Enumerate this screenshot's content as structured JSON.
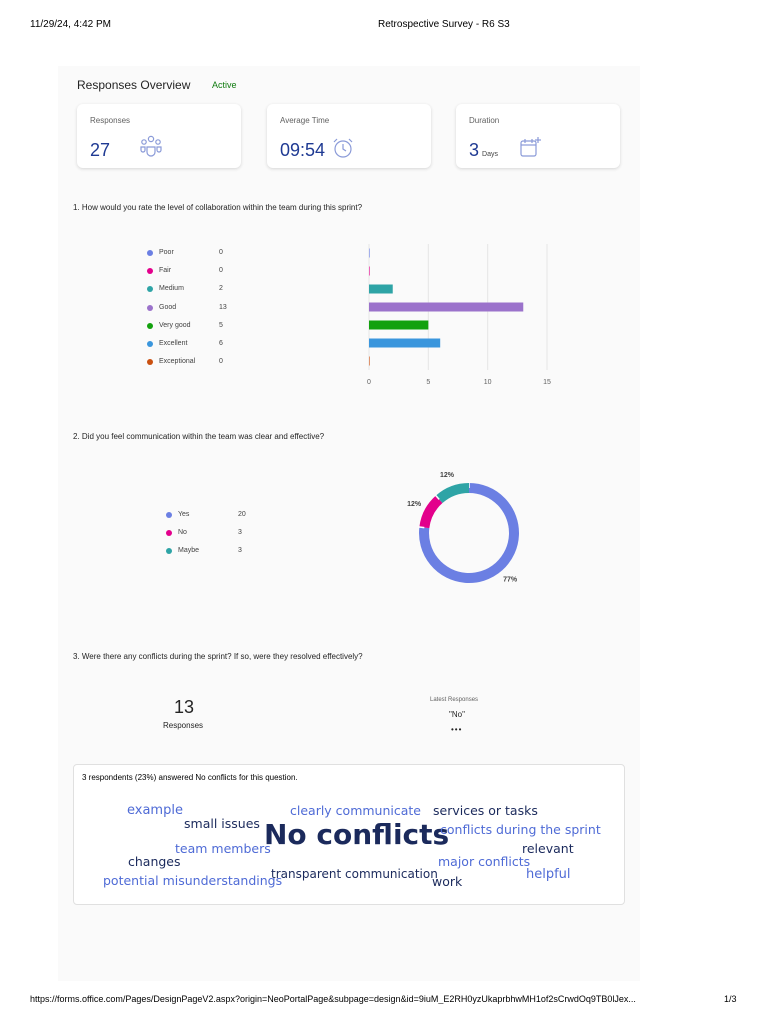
{
  "print_header": {
    "datetime": "11/29/24, 4:42 PM",
    "doc_title": "Retrospective Survey - R6 S3"
  },
  "print_footer": {
    "url": "https://forms.office.com/Pages/DesignPageV2.aspx?origin=NeoPortalPage&subpage=design&id=9iuM_E2RH0yzUkaprbhwMH1of2sCrwdOq9TB0lJex...",
    "page": "1/3"
  },
  "overview": {
    "title": "Responses Overview",
    "status": "Active",
    "cards": [
      {
        "label": "Responses",
        "value": "27",
        "unit": "",
        "icon": "people-group-icon"
      },
      {
        "label": "Average Time",
        "value": "09:54",
        "unit": "",
        "icon": "alarm-clock-icon"
      },
      {
        "label": "Duration",
        "value": "3",
        "unit": "Days",
        "icon": "calendar-add-icon"
      }
    ]
  },
  "q1": {
    "question": "1. How would you rate the level of collaboration within the team during this sprint?",
    "legend": [
      {
        "name": "Poor",
        "count": "0",
        "color": "#6b7fe3"
      },
      {
        "name": "Fair",
        "count": "0",
        "color": "#e3008c"
      },
      {
        "name": "Medium",
        "count": "2",
        "color": "#2ea4a6"
      },
      {
        "name": "Good",
        "count": "13",
        "color": "#9b72cb"
      },
      {
        "name": "Very good",
        "count": "5",
        "color": "#13a10e"
      },
      {
        "name": "Excellent",
        "count": "6",
        "color": "#3a96dd"
      },
      {
        "name": "Exceptional",
        "count": "0",
        "color": "#ca5010"
      }
    ]
  },
  "q2": {
    "question": "2. Did you feel communication within the team was clear and effective?",
    "legend": [
      {
        "name": "Yes",
        "count": "20",
        "color": "#6b7fe3"
      },
      {
        "name": "No",
        "count": "3",
        "color": "#e3008c"
      },
      {
        "name": "Maybe",
        "count": "3",
        "color": "#2ea4a6"
      }
    ]
  },
  "q3": {
    "question": "3. Were there any conflicts during the sprint? If so, were they resolved effectively?",
    "count": "13",
    "count_label": "Responses",
    "latest_label": "Latest Responses",
    "latest_value": "\"No\"",
    "more": "•••",
    "summary": "3 respondents (23%) answered No conflicts for this question.",
    "cloud": [
      {
        "text": "example",
        "color": "#4f6bd6"
      },
      {
        "text": "small issues",
        "color": "#1b2a5c"
      },
      {
        "text": "clearly communicate",
        "color": "#4f6bd6"
      },
      {
        "text": "services or tasks",
        "color": "#1b2a5c"
      },
      {
        "text": "No conflicts",
        "color": "#1b2a5c"
      },
      {
        "text": "conflicts during the sprint",
        "color": "#4f6bd6"
      },
      {
        "text": "team members",
        "color": "#4f6bd6"
      },
      {
        "text": "relevant",
        "color": "#1b2a5c"
      },
      {
        "text": "changes",
        "color": "#1b2a5c"
      },
      {
        "text": "major conflicts",
        "color": "#4f6bd6"
      },
      {
        "text": "transparent communication",
        "color": "#1b2a5c"
      },
      {
        "text": "helpful",
        "color": "#4f6bd6"
      },
      {
        "text": "potential misunderstandings",
        "color": "#4f6bd6"
      },
      {
        "text": "work",
        "color": "#1b2a5c"
      }
    ]
  },
  "chart_data": [
    {
      "type": "bar",
      "orientation": "horizontal",
      "categories": [
        "Poor",
        "Fair",
        "Medium",
        "Good",
        "Very good",
        "Excellent",
        "Exceptional"
      ],
      "values": [
        0,
        0,
        2,
        13,
        5,
        6,
        0
      ],
      "colors": [
        "#6b7fe3",
        "#e3008c",
        "#2ea4a6",
        "#9b72cb",
        "#13a10e",
        "#3a96dd",
        "#ca5010"
      ],
      "xlim": [
        0,
        15
      ],
      "xticks": [
        "0",
        "5",
        "10",
        "15"
      ],
      "grid": true
    },
    {
      "type": "pie",
      "donut": true,
      "categories": [
        "Yes",
        "No",
        "Maybe"
      ],
      "values": [
        20,
        3,
        3
      ],
      "labels": [
        "77%",
        "12%",
        "12%"
      ],
      "colors": [
        "#6b7fe3",
        "#e3008c",
        "#2ea4a6"
      ]
    }
  ]
}
